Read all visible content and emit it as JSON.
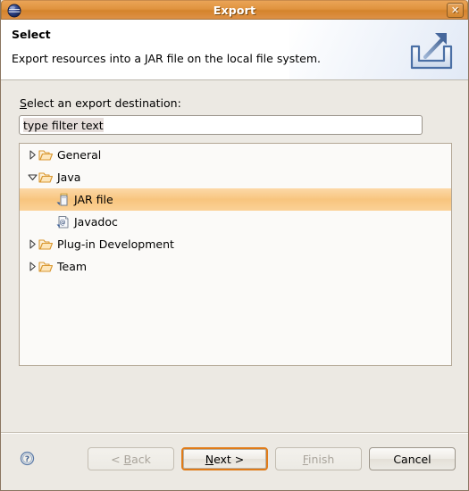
{
  "window": {
    "title": "Export",
    "app_icon": "eclipse-sphere-icon",
    "close_label": "✕"
  },
  "header": {
    "title": "Select",
    "description": "Export resources into a JAR file on the local file system.",
    "icon": "export-tray-arrow-icon"
  },
  "form": {
    "label_mnemonic": "S",
    "label_rest": "elect an export destination:",
    "filter": {
      "value": "type filter text",
      "placeholder": "type filter text",
      "selected": true
    }
  },
  "tree": {
    "items": [
      {
        "label": "General",
        "icon": "folder-icon",
        "twisty": "collapsed",
        "level": 0,
        "selected": false
      },
      {
        "label": "Java",
        "icon": "folder-icon",
        "twisty": "expanded",
        "level": 0,
        "selected": false
      },
      {
        "label": "JAR file",
        "icon": "jar-file-icon",
        "twisty": "none",
        "level": 1,
        "selected": true
      },
      {
        "label": "Javadoc",
        "icon": "javadoc-icon",
        "twisty": "none",
        "level": 1,
        "selected": false
      },
      {
        "label": "Plug-in Development",
        "icon": "folder-icon",
        "twisty": "collapsed",
        "level": 0,
        "selected": false
      },
      {
        "label": "Team",
        "icon": "folder-icon",
        "twisty": "collapsed",
        "level": 0,
        "selected": false
      }
    ]
  },
  "footer": {
    "help_icon": "help-question-icon",
    "buttons": [
      {
        "name": "back",
        "label": "< Back",
        "mnemonic": "B",
        "disabled": true,
        "focused": false
      },
      {
        "name": "next",
        "label": "Next >",
        "mnemonic": "N",
        "disabled": false,
        "focused": true
      },
      {
        "name": "finish",
        "label": "Finish",
        "mnemonic": "F",
        "disabled": true,
        "focused": false
      },
      {
        "name": "cancel",
        "label": "Cancel",
        "mnemonic": "",
        "disabled": false,
        "focused": false
      }
    ]
  },
  "colors": {
    "titlebar_orange": "#dd9146",
    "selection_orange": "#f8c57e",
    "focus_ring": "#e07b18",
    "dialog_bg": "#ece9e3",
    "tree_bg": "#fbfaf8"
  }
}
